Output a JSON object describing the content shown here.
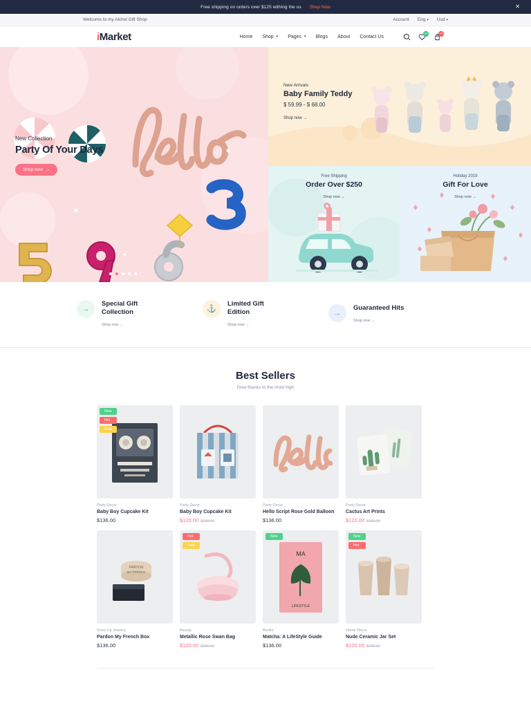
{
  "announce": {
    "text": "Free shipping on  orders over $125 withing the us",
    "link": "Shop Now",
    "close": "✕"
  },
  "topbar": {
    "welcome": "Welcome to my Alchol Gift Shop",
    "account": "Account",
    "language": "Eng",
    "currency": "Usd",
    "caret": "▾"
  },
  "header": {
    "logo_i": "i",
    "logo_rest": "Market",
    "nav": [
      {
        "label": "Home",
        "caret": ""
      },
      {
        "label": "Shop",
        "caret": "▾"
      },
      {
        "label": "Pages",
        "caret": "▾"
      },
      {
        "label": "Blogs",
        "caret": ""
      },
      {
        "label": "About",
        "caret": ""
      },
      {
        "label": "Contact Us",
        "caret": ""
      }
    ],
    "icons": {
      "search": "search-icon",
      "wishlist": "heart-icon",
      "wishlist_count": "02",
      "cart": "cart-icon",
      "cart_count": "03"
    }
  },
  "hero": {
    "eyebrow": "New Collection",
    "title": "Party Of Your Days",
    "button": "Shop now",
    "arrow": "→",
    "dots": 5,
    "active_dot": 1
  },
  "banners": {
    "teddy": {
      "eyebrow": "New Arrivals",
      "title": "Baby Family Teddy",
      "price": "$ 59.99 - $ 68.00",
      "link": "Shop now",
      "arrow": "→"
    },
    "shipping": {
      "eyebrow": "Free Shipping",
      "title": "Order Over $250",
      "link": "Shop now",
      "arrow": "→"
    },
    "gift": {
      "eyebrow": "Holiday 2019",
      "title": "Gift For Love",
      "link": "Shop now",
      "arrow": "→"
    }
  },
  "features": [
    {
      "icon": "arrow-right-icon",
      "glyph": "→",
      "title": "Special Gift Collection",
      "link": "Shop now →",
      "color": "f-green"
    },
    {
      "icon": "anchor-icon",
      "glyph": "⚓",
      "title": "Limited Gift Edition",
      "link": "Shop now →",
      "color": "f-yellow"
    },
    {
      "icon": "arrow-right-icon",
      "glyph": "→",
      "title": "Guaranteed Hits",
      "link": "Shop now →",
      "color": "f-blue"
    }
  ],
  "best_sellers": {
    "title": "Best Sellers",
    "subtitle": "Give thanks to the most high",
    "products": [
      {
        "category": "Party Decor",
        "name": "Baby Boy Cupcake Kit",
        "price": "$136.00",
        "old_price": "",
        "on_sale": false,
        "badges": [
          "New",
          "Hot",
          "Sale"
        ],
        "bg": "#edeef0"
      },
      {
        "category": "Party Decor",
        "name": "Baby Boy Cupcake Kit",
        "price": "$120.00",
        "old_price": "$230.00",
        "on_sale": true,
        "badges": [],
        "bg": "#edeef0"
      },
      {
        "category": "Party Decor",
        "name": "Hello Script Rose Gold Balloon",
        "price": "$136.00",
        "old_price": "",
        "on_sale": false,
        "badges": [],
        "bg": "#edeef0"
      },
      {
        "category": "Party Decor",
        "name": "Cactus Art Prints",
        "price": "$120.00",
        "old_price": "$230.00",
        "on_sale": true,
        "badges": [],
        "bg": "#edeef0"
      },
      {
        "category": "Grow Up Jewelry",
        "name": "Pardon My French Box",
        "price": "$136.00",
        "old_price": "",
        "on_sale": false,
        "badges": [],
        "bg": "#edeef0"
      },
      {
        "category": "Beauty",
        "name": "Metallic Rose Swan Bag",
        "price": "$120.00",
        "old_price": "$230.00",
        "on_sale": true,
        "badges": [
          "Hot",
          "Sale"
        ],
        "bg": "#edeef0"
      },
      {
        "category": "Books",
        "name": "Matcha: A LifeStyle Guide",
        "price": "$136.00",
        "old_price": "",
        "on_sale": false,
        "badges": [
          "New"
        ],
        "bg": "#edeef0"
      },
      {
        "category": "Home Decor",
        "name": "Nude Ceramic Jar Set",
        "price": "$120.00",
        "old_price": "$230.00",
        "on_sale": true,
        "badges": [
          "New",
          "Hot"
        ],
        "bg": "#edeef0"
      }
    ]
  },
  "colors": {
    "accent_pink": "#fb7185",
    "dark_navy": "#222a41",
    "green": "#4fd18b",
    "yellow": "#fcd34d",
    "orange_link": "#ff6b4a"
  }
}
